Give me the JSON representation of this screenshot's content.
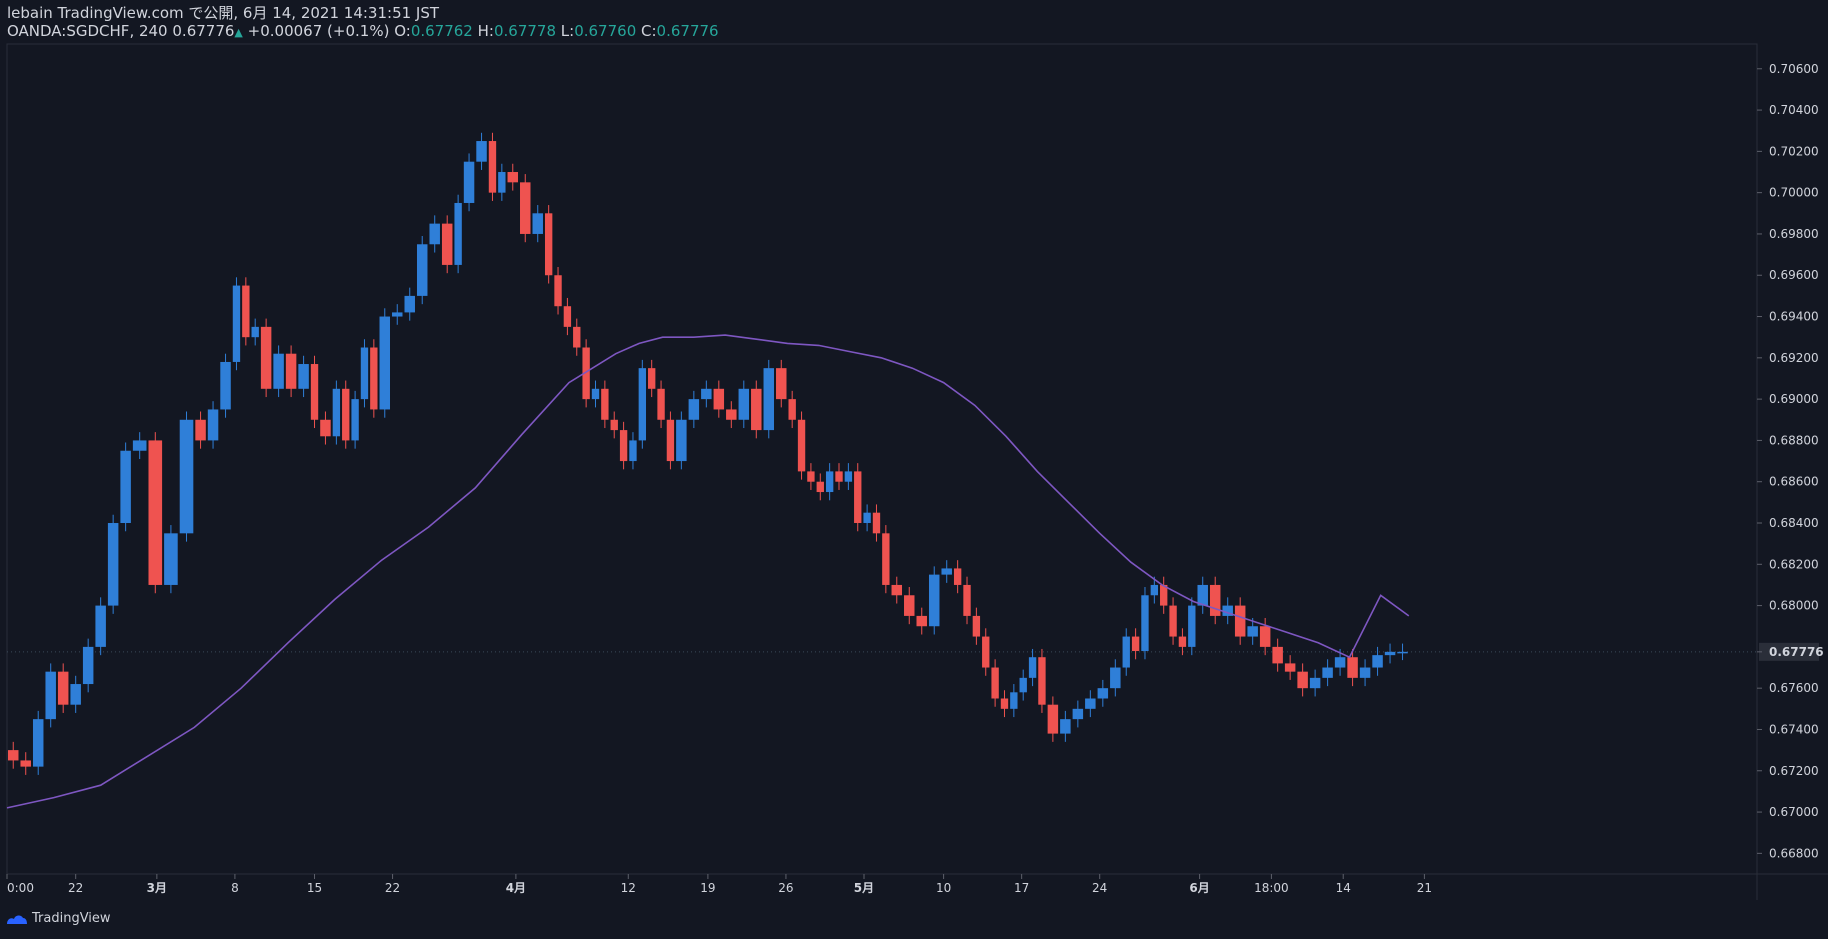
{
  "header": {
    "line1": "lebain TradingView.com で公開, 6月 14, 2021 14:31:51 JST",
    "symbol": "OANDA:SGDCHF, 240",
    "last": "0.67776",
    "change": "+0.00067 (+0.1%)",
    "o_label": "O:",
    "o_value": "0.67762",
    "h_label": "H:",
    "h_value": "0.67778",
    "l_label": "L:",
    "l_value": "0.67760",
    "c_label": "C:",
    "c_value": "0.67776"
  },
  "footer": {
    "brand": "TradingView"
  },
  "colors": {
    "background": "#131722",
    "up": "#2f7fd8",
    "down": "#ef5350",
    "ma": "#7e57c2",
    "grid": "#2a2e39",
    "axis_text": "#d1d4dc",
    "price_label_bg": "#2a2e39"
  },
  "chart_data": {
    "type": "line",
    "title": "",
    "xlabel": "",
    "ylabel": "",
    "ylim": [
      0.667,
      0.7072
    ],
    "grid": false,
    "x_ticks": [
      "0:00",
      "22",
      "3月",
      "8",
      "15",
      "22",
      "4月",
      "12",
      "19",
      "26",
      "5月",
      "10",
      "17",
      "24",
      "6月",
      "18:00",
      "14",
      "21"
    ],
    "y_ticks": [
      "0.70600",
      "0.70400",
      "0.70200",
      "0.70000",
      "0.69800",
      "0.69600",
      "0.69400",
      "0.69200",
      "0.69000",
      "0.68800",
      "0.68600",
      "0.68400",
      "0.68200",
      "0.68000",
      "0.67776",
      "0.67600",
      "0.67400",
      "0.67200",
      "0.67000",
      "0.66800"
    ],
    "last_price": "0.67776",
    "x_domain": [
      0,
      1000
    ],
    "series": [
      {
        "kind": "price",
        "x": [
          0,
          8,
          16,
          24,
          32,
          40,
          48,
          56,
          64,
          72,
          80,
          90,
          100,
          110,
          120,
          128,
          136,
          144,
          150,
          156,
          162,
          170,
          178,
          186,
          194,
          200,
          208,
          214,
          220,
          226,
          232,
          238,
          246,
          254,
          262,
          270,
          278,
          286,
          292,
          300,
          308,
          314,
          320,
          328,
          336,
          344,
          350,
          356,
          362,
          368,
          374,
          380,
          386,
          392,
          398,
          404,
          410,
          416,
          422,
          428,
          436,
          444,
          452,
          460,
          468,
          476,
          484,
          492,
          500,
          506,
          512,
          518,
          524,
          530,
          536,
          542,
          548,
          554,
          560,
          566,
          574,
          582,
          590,
          598,
          606,
          612,
          618,
          624,
          630,
          636,
          642,
          648,
          654,
          660,
          666,
          674,
          682,
          690,
          698,
          706,
          714,
          720,
          726,
          732,
          738,
          744,
          750,
          756,
          762,
          770,
          778,
          786,
          794,
          802,
          810,
          818,
          826,
          834,
          842,
          850,
          858,
          866,
          874,
          882,
          890,
          898
        ],
        "values": [
          0.673,
          0.6725,
          0.6722,
          0.6745,
          0.6768,
          0.6752,
          0.6762,
          0.678,
          0.68,
          0.684,
          0.6875,
          0.688,
          0.681,
          0.6835,
          0.689,
          0.688,
          0.6895,
          0.6918,
          0.6955,
          0.693,
          0.6935,
          0.6905,
          0.6922,
          0.6905,
          0.6917,
          0.689,
          0.6882,
          0.6905,
          0.688,
          0.69,
          0.6925,
          0.6895,
          0.694,
          0.6942,
          0.695,
          0.6975,
          0.6985,
          0.6965,
          0.6995,
          0.7015,
          0.7025,
          0.7,
          0.701,
          0.7005,
          0.698,
          0.699,
          0.696,
          0.6945,
          0.6935,
          0.6925,
          0.69,
          0.6905,
          0.689,
          0.6885,
          0.687,
          0.688,
          0.6915,
          0.6905,
          0.689,
          0.687,
          0.689,
          0.69,
          0.6905,
          0.6895,
          0.689,
          0.6905,
          0.6885,
          0.6915,
          0.69,
          0.689,
          0.6865,
          0.686,
          0.6855,
          0.6865,
          0.686,
          0.6865,
          0.684,
          0.6845,
          0.6835,
          0.681,
          0.6805,
          0.6795,
          0.679,
          0.6815,
          0.6818,
          0.681,
          0.6795,
          0.6785,
          0.677,
          0.6755,
          0.675,
          0.6758,
          0.6765,
          0.6775,
          0.6752,
          0.6738,
          0.6745,
          0.675,
          0.6755,
          0.676,
          0.677,
          0.6785,
          0.6778,
          0.6805,
          0.681,
          0.68,
          0.6785,
          0.678,
          0.68,
          0.681,
          0.6795,
          0.68,
          0.6785,
          0.679,
          0.678,
          0.6772,
          0.6768,
          0.676,
          0.6765,
          0.677,
          0.6775,
          0.6765,
          0.677,
          0.6776,
          0.67776,
          0.67776
        ]
      },
      {
        "kind": "moving-average",
        "x": [
          0,
          30,
          60,
          90,
          120,
          150,
          180,
          210,
          240,
          270,
          300,
          330,
          360,
          390,
          405,
          420,
          440,
          460,
          480,
          500,
          520,
          540,
          560,
          580,
          600,
          620,
          640,
          660,
          680,
          700,
          720,
          740,
          760,
          780,
          800,
          820,
          840,
          860,
          880,
          898
        ],
        "values": [
          0.6702,
          0.6707,
          0.6713,
          0.6727,
          0.6741,
          0.676,
          0.6782,
          0.6803,
          0.6822,
          0.6838,
          0.6857,
          0.6883,
          0.6908,
          0.6922,
          0.6927,
          0.693,
          0.693,
          0.6931,
          0.6929,
          0.6927,
          0.6926,
          0.6923,
          0.692,
          0.6915,
          0.6908,
          0.6897,
          0.6882,
          0.6865,
          0.685,
          0.6835,
          0.6821,
          0.681,
          0.6802,
          0.6797,
          0.6792,
          0.6787,
          0.6782,
          0.6775,
          0.6805,
          0.6795
        ]
      }
    ]
  }
}
